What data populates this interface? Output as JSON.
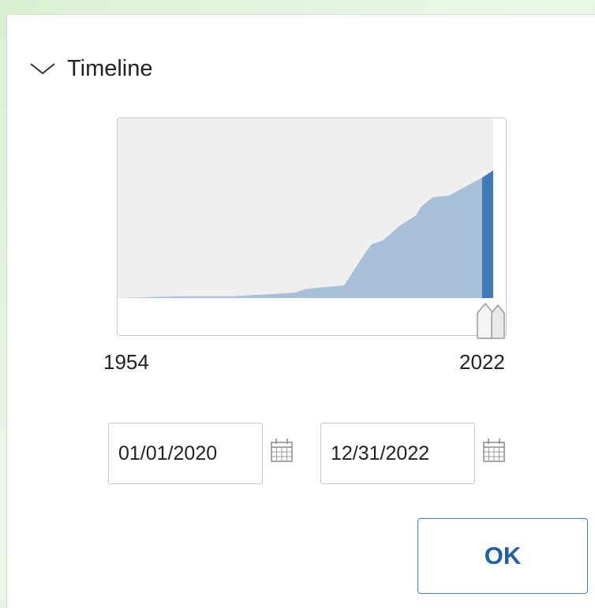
{
  "timeline": {
    "title": "Timeline",
    "icon": "chevron-down-icon",
    "start_year_label": "1954",
    "end_year_label": "2022",
    "from_date": "01/01/2020",
    "to_date": "12/31/2022",
    "ok_label": "OK"
  },
  "chart_data": {
    "type": "area",
    "x_range": [
      1954,
      2022
    ],
    "selected_range": [
      2020,
      2022
    ],
    "series": [
      {
        "x": [
          1954,
          1965,
          1975,
          1986,
          1988,
          1991,
          1995,
          1999,
          2000,
          2002,
          2005,
          2008,
          2009,
          2011,
          2014,
          2017,
          2020,
          2022
        ],
        "values": [
          0.0,
          0.01,
          0.01,
          0.03,
          0.05,
          0.06,
          0.07,
          0.26,
          0.3,
          0.32,
          0.4,
          0.46,
          0.51,
          0.56,
          0.57,
          0.62,
          0.67,
          0.71
        ]
      }
    ],
    "colors": {
      "fill": "#a8bfd9",
      "selected_fill": "#3f7bb8",
      "background": "#efefef"
    },
    "grid": false
  }
}
